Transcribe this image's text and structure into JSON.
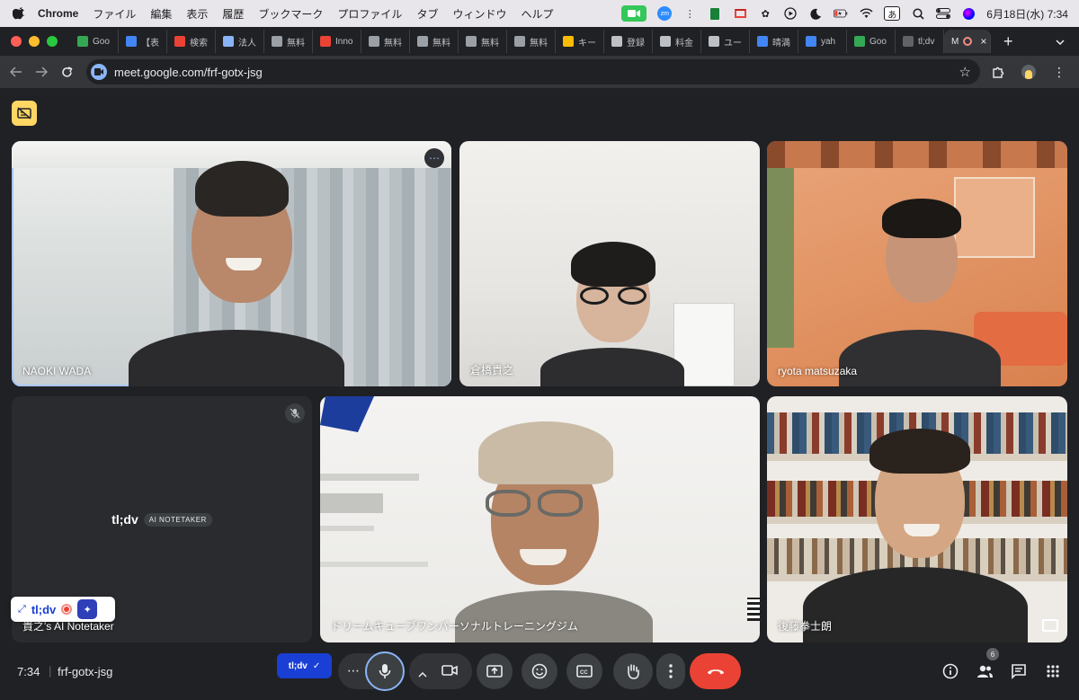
{
  "menubar": {
    "app_name": "Chrome",
    "menus": [
      "ファイル",
      "編集",
      "表示",
      "履歴",
      "ブックマーク",
      "プロファイル",
      "タブ",
      "ウィンドウ",
      "ヘルプ"
    ],
    "ime_label": "あ",
    "zoom_icon_label": "zm",
    "datetime": "6月18日(水)  7:34"
  },
  "tabs": [
    {
      "label": "Goo",
      "color": "#34a853"
    },
    {
      "label": "【表",
      "color": "#4285f4"
    },
    {
      "label": "検索",
      "color": "#ea4335"
    },
    {
      "label": "法人",
      "color": "#8ab4f8"
    },
    {
      "label": "無料",
      "color": "#9aa0a6"
    },
    {
      "label": "Inno",
      "color": "#ea4335"
    },
    {
      "label": "無料",
      "color": "#9aa0a6"
    },
    {
      "label": "無料",
      "color": "#9aa0a6"
    },
    {
      "label": "無料",
      "color": "#9aa0a6"
    },
    {
      "label": "無料",
      "color": "#9aa0a6"
    },
    {
      "label": "キー",
      "color": "#fbbc04"
    },
    {
      "label": "登録",
      "color": "#bdc1c6"
    },
    {
      "label": "料金",
      "color": "#bdc1c6"
    },
    {
      "label": "ユー",
      "color": "#bdc1c6"
    },
    {
      "label": "晴満",
      "color": "#4285f4"
    },
    {
      "label": "yah",
      "color": "#4285f4"
    },
    {
      "label": "Goo",
      "color": "#34a853"
    },
    {
      "label": "tl;dv",
      "color": "#5f6368"
    }
  ],
  "active_tab": {
    "label": "M",
    "close": "×"
  },
  "new_tab": "+",
  "address": {
    "url": "meet.google.com/frf-gotx-jsg"
  },
  "participants": [
    {
      "name": "NAOKI WADA"
    },
    {
      "name": "倉橋貴之"
    },
    {
      "name": "ryota matsuzaka"
    },
    {
      "name": "貴之's AI Notetaker"
    },
    {
      "name": "ドリームキューブワンパーソナルトレーニングジム"
    },
    {
      "name": "後藤拳士朗"
    }
  ],
  "notetaker": {
    "logo": "tl;dv",
    "badge": "AI NOTETAKER"
  },
  "tldv_widget": {
    "logo": "tl;dv"
  },
  "bottom": {
    "time": "7:34",
    "separator": "|",
    "meeting_code": "frf-gotx-jsg",
    "tldv_button": "tl;dv",
    "people_count": "6"
  },
  "icons": {
    "more": "⋯",
    "mic": "microphone-icon",
    "camera": "camera-icon"
  }
}
